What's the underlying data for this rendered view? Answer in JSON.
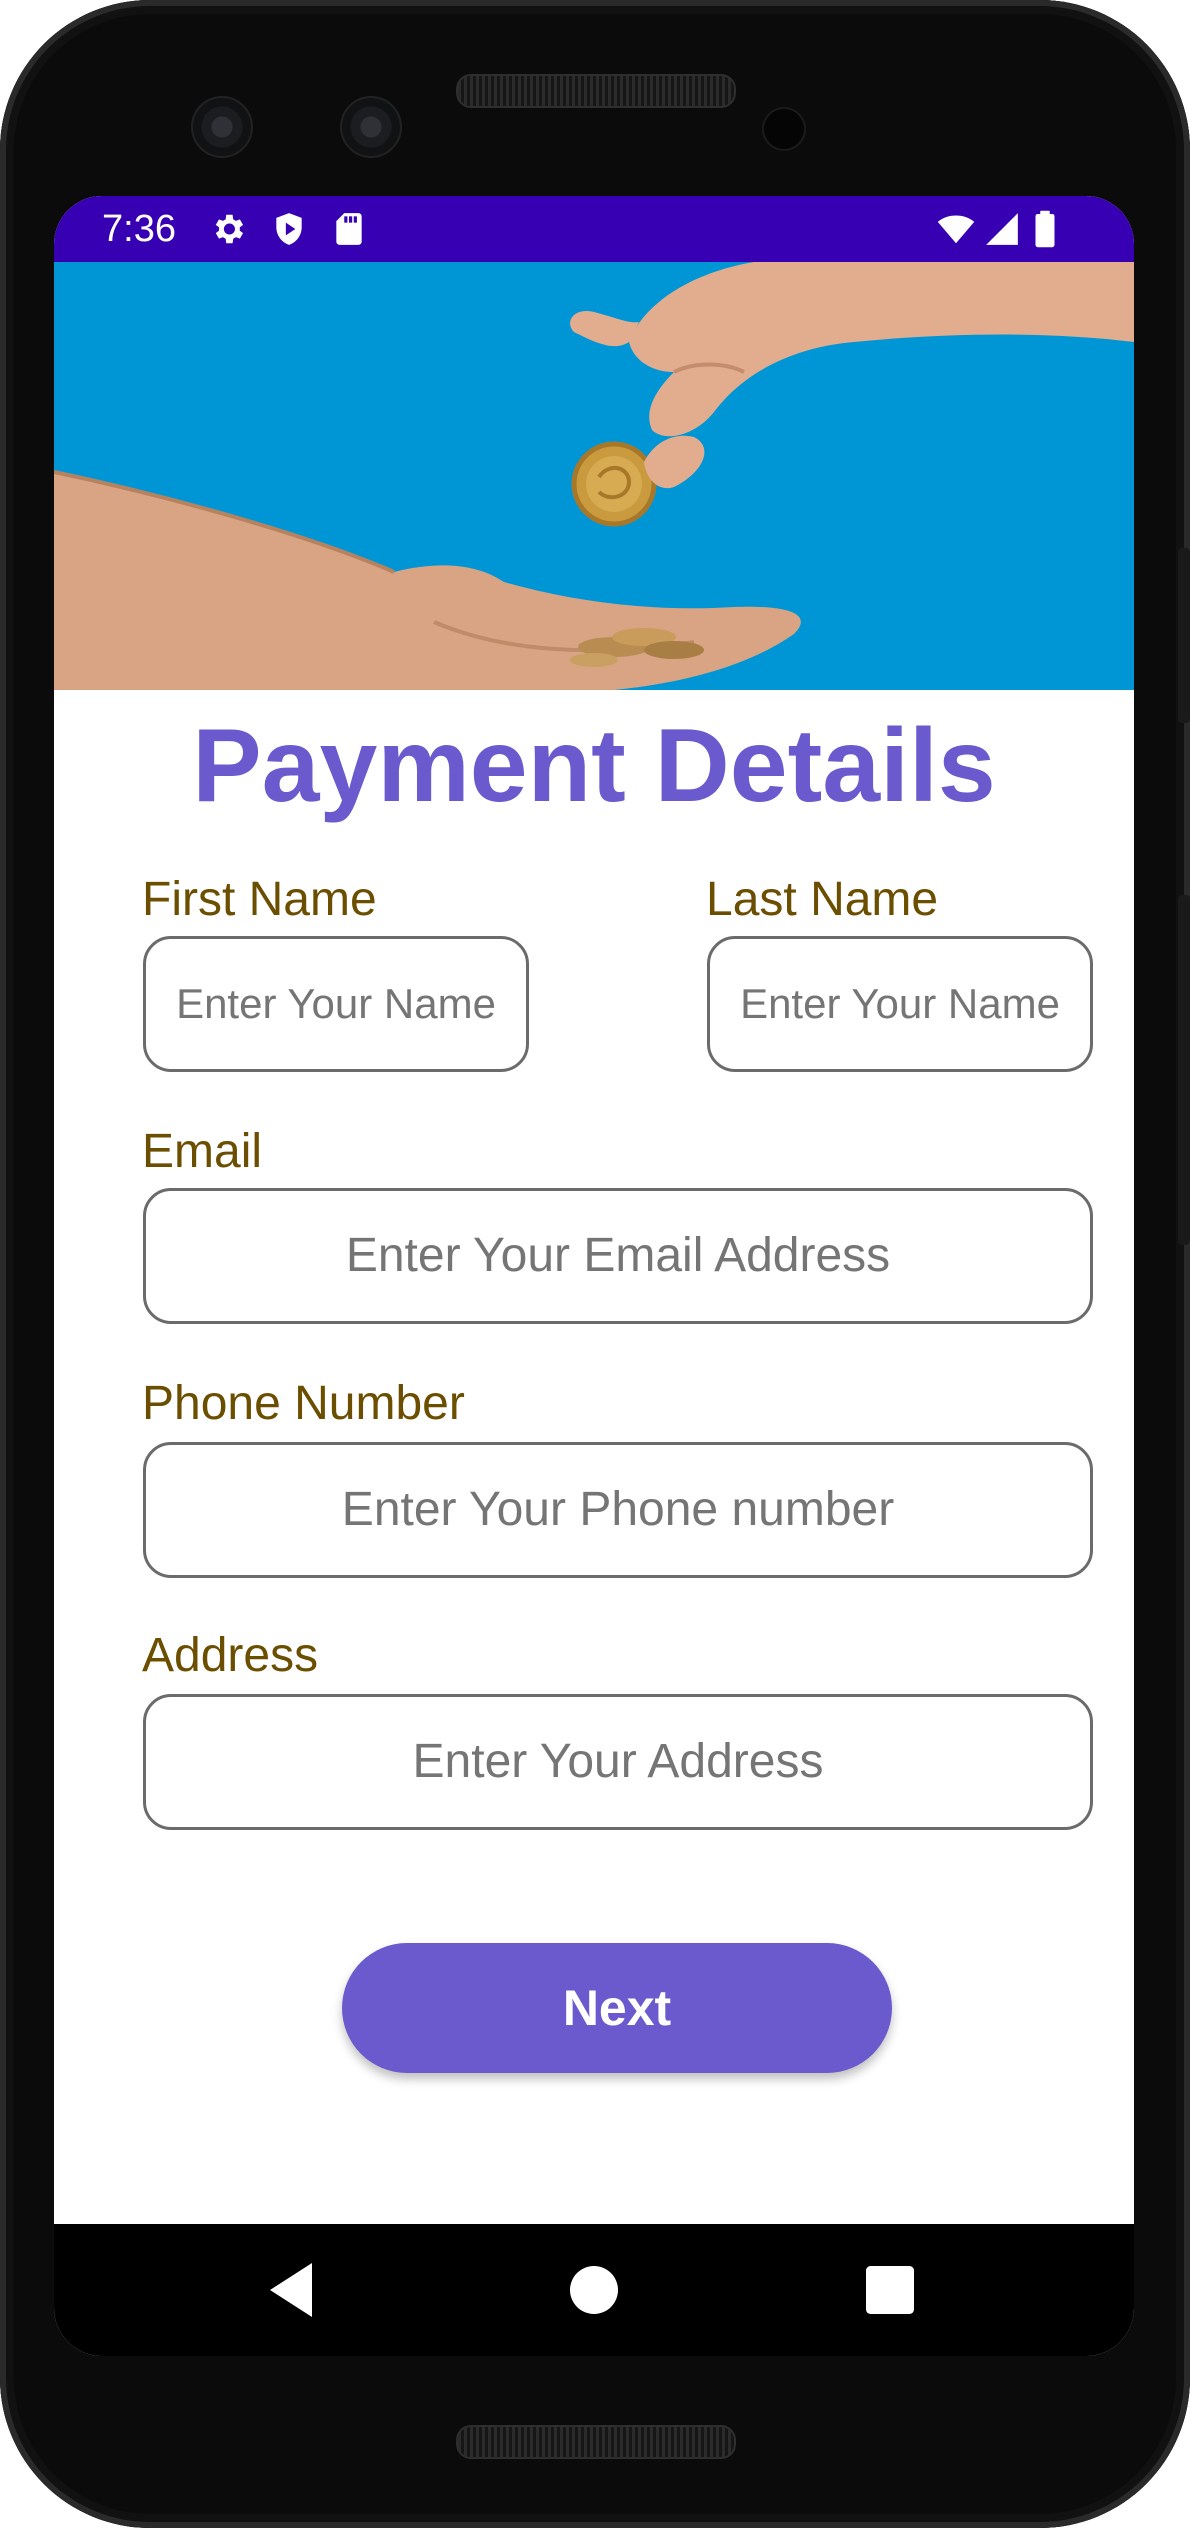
{
  "status_bar": {
    "time": "7:36",
    "left_icons": [
      "gear-icon",
      "shield-play-icon",
      "sd-card-icon"
    ],
    "right_icons": [
      "wifi-icon",
      "signal-icon",
      "battery-icon"
    ],
    "color": "#3700b3"
  },
  "hero": {
    "image": "hand-dropping-coin-into-open-hand",
    "background_color": "#0096d6"
  },
  "form": {
    "title": "Payment Details",
    "first_name": {
      "label": "First Name",
      "placeholder": "Enter Your Name"
    },
    "last_name": {
      "label": "Last Name",
      "placeholder": "Enter Your Name"
    },
    "email": {
      "label": "Email",
      "placeholder": "Enter Your Email Address"
    },
    "phone": {
      "label": "Phone Number",
      "placeholder": "Enter Your Phone number"
    },
    "address": {
      "label": "Address",
      "placeholder": "Enter Your Address"
    },
    "next_label": "Next"
  },
  "nav_bar": {
    "buttons": [
      "back-icon",
      "home-icon",
      "recents-icon"
    ]
  },
  "colors": {
    "accent": "#6a5acd",
    "label": "#6b4e00",
    "placeholder": "#757575"
  }
}
